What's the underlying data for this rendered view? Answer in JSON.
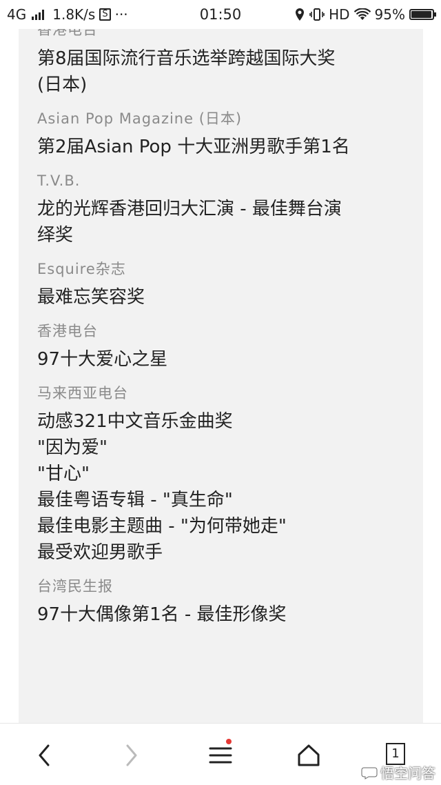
{
  "status_bar": {
    "network": "4G",
    "speed": "1.8K/s",
    "notif_icon": "S",
    "more": "···",
    "time": "01:50",
    "hd": "HD",
    "battery_percent": "95%",
    "battery_level": 0.95
  },
  "content": {
    "top_org": "香港电台",
    "entries": [
      {
        "org": "",
        "award_lines": [
          "第8届国际流行音乐选举跨越国际大奖",
          "(日本)"
        ]
      },
      {
        "org": "Asian Pop Magazine (日本)",
        "award_lines": [
          "第2届Asian Pop 十大亚洲男歌手第1名"
        ]
      },
      {
        "org": "T.V.B.",
        "award_lines": [
          "龙的光辉香港回归大汇演 - 最佳舞台演",
          "绎奖"
        ]
      },
      {
        "org": "Esquire杂志",
        "award_lines": [
          "最难忘笑容奖"
        ]
      },
      {
        "org": "香港电台",
        "award_lines": [
          "97十大爱心之星"
        ]
      },
      {
        "org": "马来西亚电台",
        "award_lines": [
          "动感321中文音乐金曲奖",
          "\"因为爱\"",
          "\"甘心\"",
          "最佳粤语专辑 - \"真生命\"",
          "最佳电影主题曲 - \"为何带她走\"",
          "最受欢迎男歌手"
        ]
      },
      {
        "org": "台湾民生报",
        "award_lines": [
          "97十大偶像第1名 - 最佳形像奖"
        ]
      }
    ]
  },
  "bottom_nav": {
    "tab_count": "1",
    "watermark": "悟空问答",
    "icons": [
      "back-arrow-icon",
      "forward-arrow-icon",
      "menu-icon",
      "home-icon",
      "tabs-icon"
    ]
  }
}
